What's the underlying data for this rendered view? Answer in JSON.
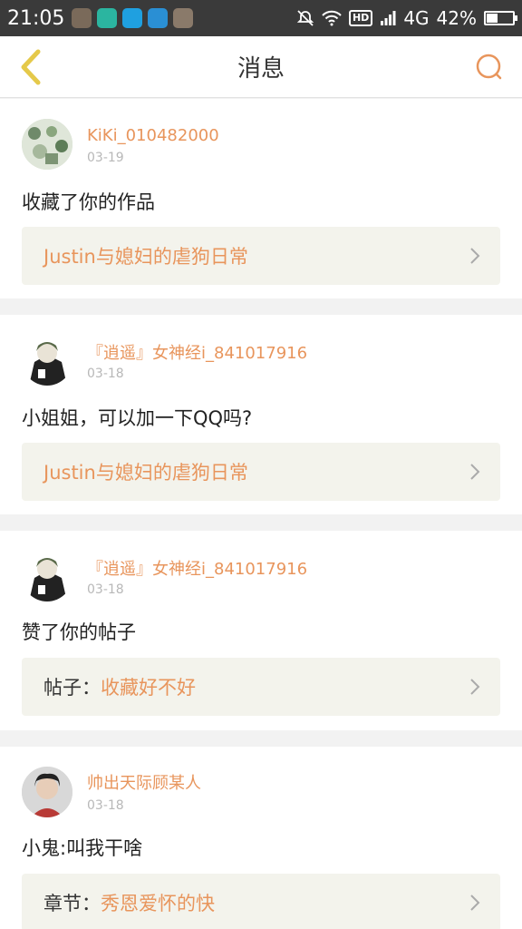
{
  "status_bar": {
    "time": "21:05",
    "network": "4G",
    "battery_percent": "42%",
    "battery_level": 0.42,
    "icons": [
      "app-icon-1",
      "app-icon-2",
      "chat-icon",
      "scan-icon",
      "app-icon-5",
      "mute-icon",
      "wifi-icon",
      "hd-icon",
      "signal-icon",
      "battery-icon"
    ]
  },
  "nav": {
    "title": "消息",
    "back_icon": "chevron-left-icon",
    "search_icon": "search-icon"
  },
  "colors": {
    "accent": "#e8955c",
    "back": "#e5c94a",
    "ref_bg": "#f3f3ec"
  },
  "messages": [
    {
      "user": "KiKi_010482000",
      "date": "03-19",
      "text": "收藏了你的作品",
      "ref_prefix": "",
      "ref_title": "Justin与媳妇的虐狗日常"
    },
    {
      "user": "『逍遥』女神经i_841017916",
      "date": "03-18",
      "text": "小姐姐，可以加一下QQ吗?",
      "ref_prefix": "",
      "ref_title": "Justin与媳妇的虐狗日常"
    },
    {
      "user": "『逍遥』女神经i_841017916",
      "date": "03-18",
      "text": "赞了你的帖子",
      "ref_prefix": "帖子：",
      "ref_title": "收藏好不好"
    },
    {
      "user": "帅出天际顾某人",
      "date": "03-18",
      "text": "小鬼:叫我干啥",
      "ref_prefix": "章节：",
      "ref_title": "秀恩爱怀的快"
    }
  ]
}
